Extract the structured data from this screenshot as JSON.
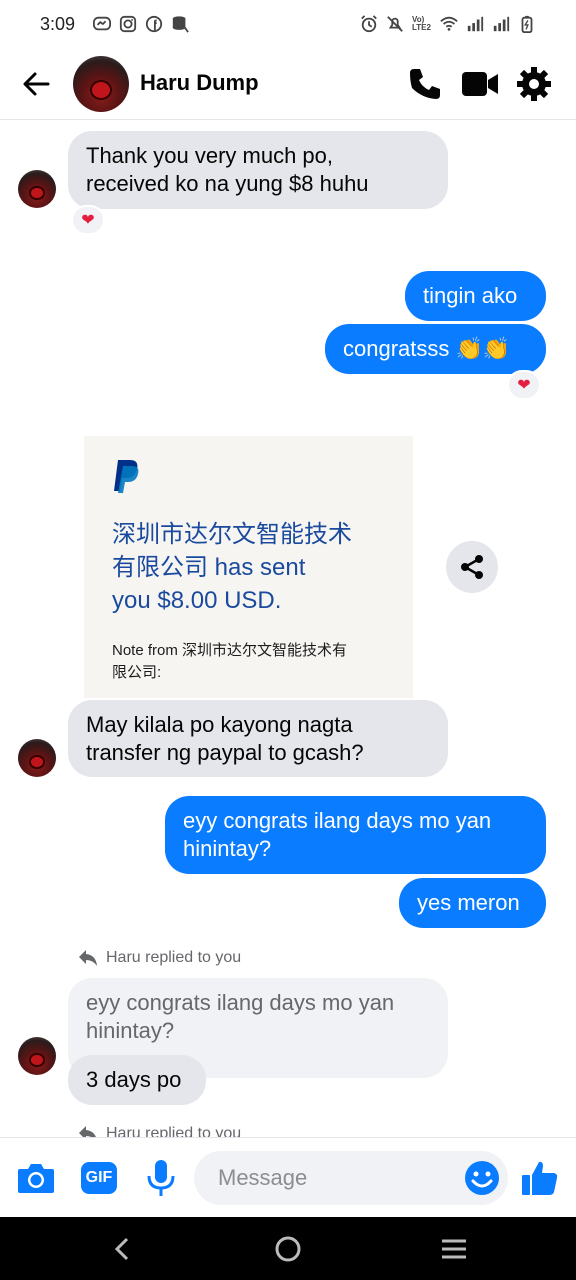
{
  "status_bar": {
    "time": "3:09",
    "left_icons": [
      "messenger-notif-icon",
      "instagram-icon",
      "facebook-icon",
      "storage-icon"
    ],
    "right_icons": [
      "alarm-icon",
      "mute-icon",
      "volte-icon",
      "wifi-icon",
      "signal-icon",
      "signal-icon",
      "battery-icon"
    ],
    "volte_text": "Vo) LTE2"
  },
  "header": {
    "contact_name": "Haru Dump",
    "accent": "#0a7cff"
  },
  "messages": [
    {
      "id": "m1",
      "direction": "incoming",
      "text": "Thank you very much po,\nreceived ko na yung $8 huhu",
      "reaction": "❤"
    },
    {
      "id": "m2",
      "direction": "outgoing",
      "text": "tingin ako"
    },
    {
      "id": "m3",
      "direction": "outgoing",
      "text": "congratsss 👏👏",
      "reaction": "❤"
    },
    {
      "id": "m4",
      "direction": "incoming",
      "type": "paypal-card"
    },
    {
      "id": "m5",
      "direction": "incoming",
      "text": "May kilala po kayong nagta\ntransfer ng paypal to gcash?"
    },
    {
      "id": "m6",
      "direction": "outgoing",
      "text": "eyy congrats ilang days mo yan\nhinintay?"
    },
    {
      "id": "m7",
      "direction": "outgoing",
      "text": "yes meron"
    },
    {
      "id": "m8",
      "direction": "incoming",
      "reply_label": "Haru replied to you",
      "quoted_text": "eyy congrats ilang days mo yan\nhinintay?",
      "text": "3 days po"
    },
    {
      "id": "m9",
      "reply_label": "Haru replied to you"
    }
  ],
  "paypal_card": {
    "main_text": "深圳市达尔文智能技术\n有限公司 has sent\nyou $8.00 USD.",
    "note": "Note from 深圳市达尔文智能技术有\n限公司:",
    "brand_color": "#003087"
  },
  "composer": {
    "placeholder": "Message",
    "gif_label": "GIF"
  }
}
